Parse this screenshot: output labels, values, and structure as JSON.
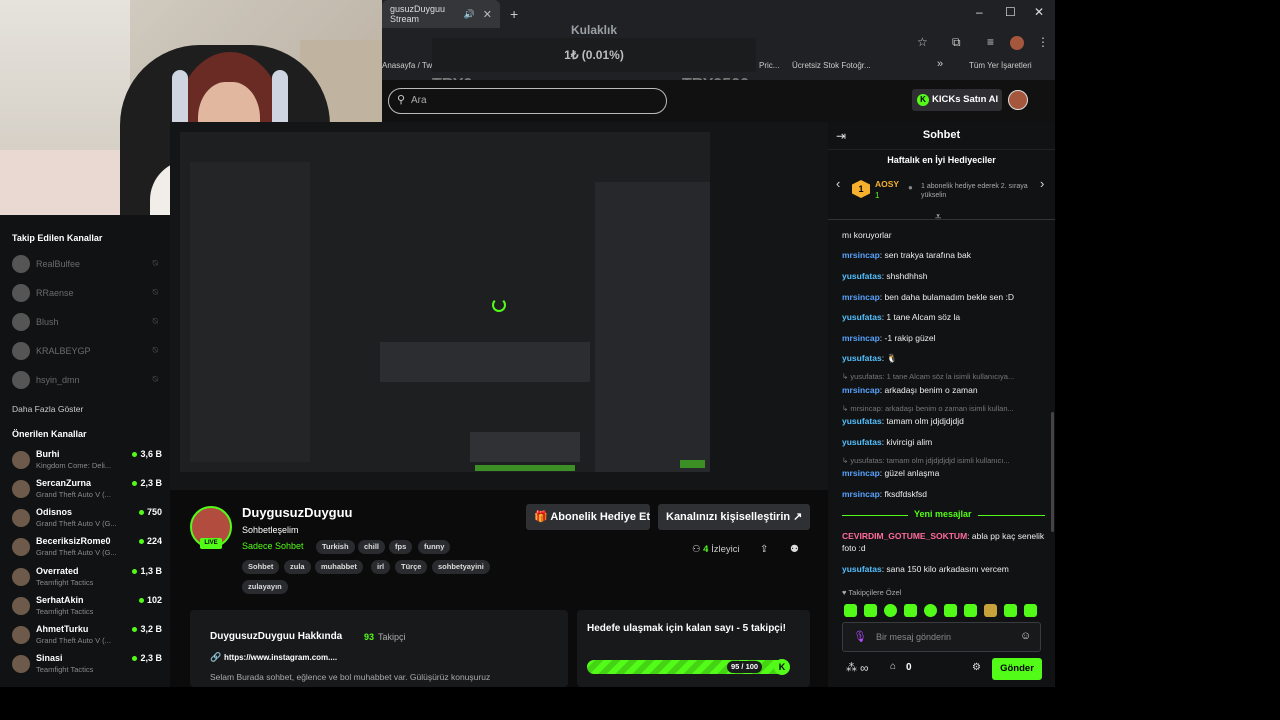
{
  "browser": {
    "tab_title": "gusuzDuyguu Stream",
    "new_tab": "+",
    "window_controls": {
      "minimize": "–",
      "maximize": "☐",
      "close": "✕"
    },
    "bookmarks": [
      "Anasayfa / Twi",
      "Pric...",
      "Ücretsiz Stok Fotoğr...",
      "»",
      "Tüm Yer İşaretleri"
    ]
  },
  "audio_popup": {
    "title": "Kulaklık",
    "amount": "1₺ (0.01%)",
    "min": "TRY0",
    "max": "TRY9500"
  },
  "header": {
    "search_placeholder": "Ara",
    "kicks_button": "KICKs Satın Al"
  },
  "sidebar": {
    "followed_heading": "Takip Edilen Kanallar",
    "followed": [
      "RealBulfee",
      "RRaense",
      "Blush",
      "KRALBEYGP",
      "hsyin_dmn"
    ],
    "show_more": "Daha Fazla Göster",
    "recommended_heading": "Önerilen Kanallar",
    "recommended": [
      {
        "name": "Burhi",
        "game": "Kingdom Come: Deli...",
        "viewers": "3,6 B"
      },
      {
        "name": "SercanZurna",
        "game": "Grand Theft Auto V (...",
        "viewers": "2,3 B"
      },
      {
        "name": "Odisnos",
        "game": "Grand Theft Auto V (G...",
        "viewers": "750"
      },
      {
        "name": "BeceriksizRome0",
        "game": "Grand Theft Auto V (G...",
        "viewers": "224"
      },
      {
        "name": "Overrated",
        "game": "Teamfight Tactics",
        "viewers": "1,3 B"
      },
      {
        "name": "SerhatAkin",
        "game": "Teamfight Tactics",
        "viewers": "102"
      },
      {
        "name": "AhmetTurku",
        "game": "Grand Theft Auto V (...",
        "viewers": "3,2 B"
      },
      {
        "name": "Sinasi",
        "game": "Teamfight Tactics",
        "viewers": "2,3 B"
      }
    ]
  },
  "channel": {
    "name": "DuygusuzDuyguu",
    "title": "Sohbetleşelim",
    "live": "LIVE",
    "category": "Sadece Sohbet",
    "tags": [
      "Turkish",
      "chill",
      "fps",
      "funny",
      "Sohbet",
      "zula",
      "muhabbet",
      "irl",
      "Türçe",
      "sohbetyayini",
      "zulayayın"
    ],
    "gift_sub_button": "Abonelik Hediye Et",
    "customize_button": "Kanalınızı kişiselleştirin",
    "viewers_count": "4",
    "viewers_label": "İzleyici"
  },
  "about": {
    "heading": "DuygusuzDuyguu Hakkında",
    "followers_count": "93",
    "followers_label": "Takipçi",
    "link": "https://www.instagram.com....",
    "description": "Selam Burada sohbet, eğlence ve bol muhabbet var. Gülüşürüz konuşuruz"
  },
  "goal": {
    "title": "Hedefe ulaşmak için kalan sayı - 5 takipçi!",
    "progress_label": "95 / 100",
    "progress_fraction": 0.95
  },
  "chat": {
    "title": "Sohbet",
    "top_gifters_title": "Haftalık en İyi Hediyeciler",
    "gifter_rank": "1",
    "gifter_name": "AOSY",
    "gifter_count": "1",
    "gifter_hint": "1 abonelik hediye ederek 2. sıraya yükselin",
    "messages": [
      {
        "user": "",
        "text": "mı koruyorlar"
      },
      {
        "user": "mrsincap",
        "text": ": sen trakya tarafına bak"
      },
      {
        "user": "yusufatas",
        "text": ": shshdhhsh"
      },
      {
        "user": "mrsincap",
        "text": ": ben daha bulamadım bekle sen :D"
      },
      {
        "user": "yusufatas",
        "text": ": 1 tane Alcam söz la"
      },
      {
        "user": "mrsincap",
        "text": ": -1 rakip güzel"
      },
      {
        "user": "yusufatas",
        "text": ":"
      },
      {
        "reply": "yusufatas: 1 tane Alcam söz la isimli kullanıcıya...",
        "user": "mrsincap",
        "text": ": arkadaşı benim o zaman"
      },
      {
        "reply": "mrsincap: arkadaşı benim o zaman isimli kullan...",
        "user": "yusufatas",
        "text": ": tamam olm jdjdjdjdjd"
      },
      {
        "user": "yusufatas",
        "text": ": kivircigi alim"
      },
      {
        "reply": "yusufatas: tamam olm jdjdjdjdjd isimli kullanıcı...",
        "user": "mrsincap",
        "text": ": güzel anlaşma"
      },
      {
        "user": "mrsincap",
        "text": ": fksdfdskfsd"
      }
    ],
    "new_messages": "Yeni mesajlar",
    "new": [
      {
        "user": "CEVIRDIM_GOTUME_SOKTUM",
        "text": ": abla pp kaç senelik foto :d"
      },
      {
        "user": "yusufatas",
        "text": ": sana 150 kilo arkadasını vercem"
      }
    ],
    "followers_special": "Takipçilere Özel",
    "input_placeholder": "Bir mesaj gönderin",
    "points": "∞",
    "kicks": "0",
    "send": "Gönder"
  }
}
